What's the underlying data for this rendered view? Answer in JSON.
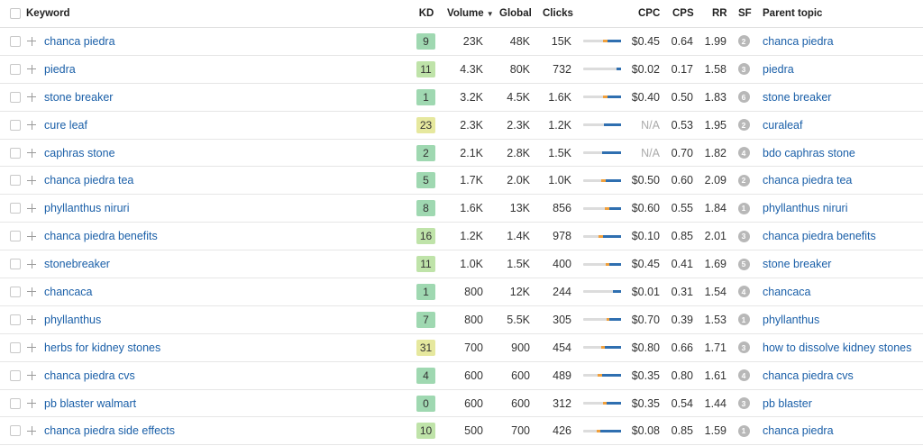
{
  "header": {
    "keyword": "Keyword",
    "kd": "KD",
    "volume": "Volume",
    "global": "Global",
    "clicks": "Clicks",
    "cpc": "CPC",
    "cps": "CPS",
    "rr": "RR",
    "sf": "SF",
    "parent": "Parent topic"
  },
  "colors": {
    "link": "#1a5fa8",
    "kd_low": "#9fd8b1",
    "kd_mid": "#c5e4a7",
    "kd_high": "#e2e49b",
    "bar_blue": "#2f6fb0",
    "bar_orange": "#f0a03c",
    "bar_track": "#dcdcdc",
    "sf_badge": "#b8b8b8"
  },
  "rows": [
    {
      "keyword": "chanca piedra",
      "kd": "9",
      "volume": "23K",
      "global": "48K",
      "clicks": "15K",
      "paid": 0.12,
      "organic": 0.35,
      "cpc": "$0.45",
      "cps": "0.64",
      "rr": "1.99",
      "sf": "2",
      "parent": "chanca piedra"
    },
    {
      "keyword": "piedra",
      "kd": "11",
      "volume": "4.3K",
      "global": "80K",
      "clicks": "732",
      "paid": 0.0,
      "organic": 0.12,
      "cpc": "$0.02",
      "cps": "0.17",
      "rr": "1.58",
      "sf": "3",
      "parent": "piedra"
    },
    {
      "keyword": "stone breaker",
      "kd": "1",
      "volume": "3.2K",
      "global": "4.5K",
      "clicks": "1.6K",
      "paid": 0.12,
      "organic": 0.35,
      "cpc": "$0.40",
      "cps": "0.50",
      "rr": "1.83",
      "sf": "6",
      "parent": "stone breaker"
    },
    {
      "keyword": "cure leaf",
      "kd": "23",
      "volume": "2.3K",
      "global": "2.3K",
      "clicks": "1.2K",
      "paid": 0.0,
      "organic": 0.45,
      "cpc": "N/A",
      "cps": "0.53",
      "rr": "1.95",
      "sf": "2",
      "parent": "curaleaf"
    },
    {
      "keyword": "caphras stone",
      "kd": "2",
      "volume": "2.1K",
      "global": "2.8K",
      "clicks": "1.5K",
      "paid": 0.0,
      "organic": 0.5,
      "cpc": "N/A",
      "cps": "0.70",
      "rr": "1.82",
      "sf": "4",
      "parent": "bdo caphras stone"
    },
    {
      "keyword": "chanca piedra tea",
      "kd": "5",
      "volume": "1.7K",
      "global": "2.0K",
      "clicks": "1.0K",
      "paid": 0.12,
      "organic": 0.4,
      "cpc": "$0.50",
      "cps": "0.60",
      "rr": "2.09",
      "sf": "2",
      "parent": "chanca piedra tea"
    },
    {
      "keyword": "phyllanthus niruri",
      "kd": "8",
      "volume": "1.6K",
      "global": "13K",
      "clicks": "856",
      "paid": 0.12,
      "organic": 0.3,
      "cpc": "$0.60",
      "cps": "0.55",
      "rr": "1.84",
      "sf": "1",
      "parent": "phyllanthus niruri"
    },
    {
      "keyword": "chanca piedra benefits",
      "kd": "16",
      "volume": "1.2K",
      "global": "1.4K",
      "clicks": "978",
      "paid": 0.12,
      "organic": 0.48,
      "cpc": "$0.10",
      "cps": "0.85",
      "rr": "2.01",
      "sf": "3",
      "parent": "chanca piedra benefits"
    },
    {
      "keyword": "stonebreaker",
      "kd": "11",
      "volume": "1.0K",
      "global": "1.5K",
      "clicks": "400",
      "paid": 0.1,
      "organic": 0.3,
      "cpc": "$0.45",
      "cps": "0.41",
      "rr": "1.69",
      "sf": "5",
      "parent": "stone breaker"
    },
    {
      "keyword": "chancaca",
      "kd": "1",
      "volume": "800",
      "global": "12K",
      "clicks": "244",
      "paid": 0.0,
      "organic": 0.22,
      "cpc": "$0.01",
      "cps": "0.31",
      "rr": "1.54",
      "sf": "4",
      "parent": "chancaca"
    },
    {
      "keyword": "phyllanthus",
      "kd": "7",
      "volume": "800",
      "global": "5.5K",
      "clicks": "305",
      "paid": 0.08,
      "organic": 0.3,
      "cpc": "$0.70",
      "cps": "0.39",
      "rr": "1.53",
      "sf": "1",
      "parent": "phyllanthus"
    },
    {
      "keyword": "herbs for kidney stones",
      "kd": "31",
      "volume": "700",
      "global": "900",
      "clicks": "454",
      "paid": 0.1,
      "organic": 0.42,
      "cpc": "$0.80",
      "cps": "0.66",
      "rr": "1.71",
      "sf": "3",
      "parent": "how to dissolve kidney stones"
    },
    {
      "keyword": "chanca piedra cvs",
      "kd": "4",
      "volume": "600",
      "global": "600",
      "clicks": "489",
      "paid": 0.12,
      "organic": 0.5,
      "cpc": "$0.35",
      "cps": "0.80",
      "rr": "1.61",
      "sf": "4",
      "parent": "chanca piedra cvs"
    },
    {
      "keyword": "pb blaster walmart",
      "kd": "0",
      "volume": "600",
      "global": "600",
      "clicks": "312",
      "paid": 0.1,
      "organic": 0.38,
      "cpc": "$0.35",
      "cps": "0.54",
      "rr": "1.44",
      "sf": "3",
      "parent": "pb blaster"
    },
    {
      "keyword": "chanca piedra side effects",
      "kd": "10",
      "volume": "500",
      "global": "700",
      "clicks": "426",
      "paid": 0.1,
      "organic": 0.55,
      "cpc": "$0.08",
      "cps": "0.85",
      "rr": "1.59",
      "sf": "1",
      "parent": "chanca piedra"
    }
  ]
}
